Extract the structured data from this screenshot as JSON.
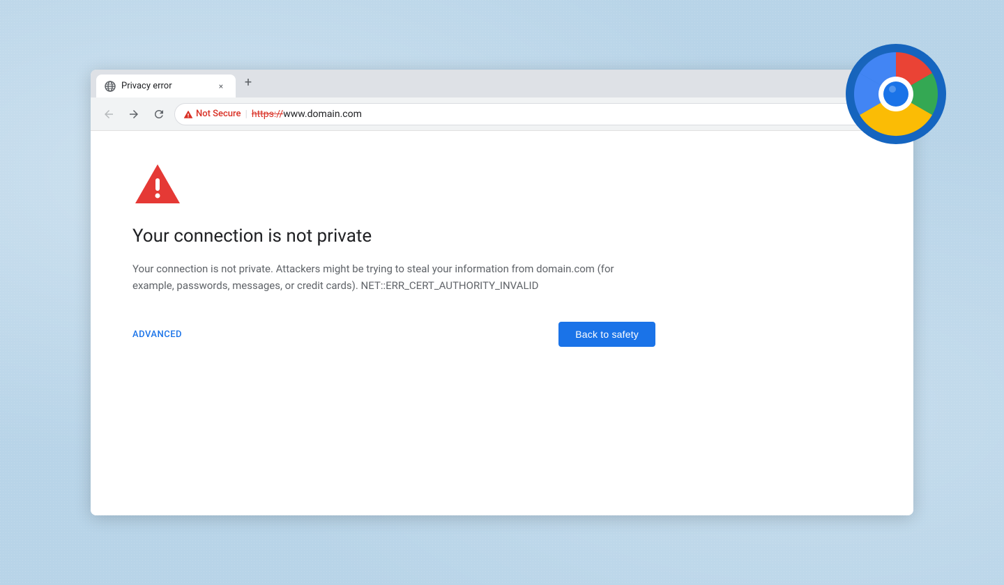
{
  "browser": {
    "tab": {
      "favicon_label": "globe-icon",
      "title": "Privacy error",
      "close_label": "×"
    },
    "new_tab_label": "+",
    "nav": {
      "back_label": "←",
      "forward_label": "→",
      "reload_label": "↻"
    },
    "omnibox": {
      "not_secure_label": "Not Secure",
      "divider": "|",
      "url_protocol": "https://",
      "url_domain": "www.domain.com"
    }
  },
  "error_page": {
    "title": "Your connection is not private",
    "description": "Your connection is not private. Attackers might be trying to steal your information from domain.com (for example, passwords, messages, or credit cards). NET::ERR_CERT_AUTHORITY_INVALID",
    "advanced_label": "ADVANCED",
    "back_to_safety_label": "Back to safety"
  },
  "colors": {
    "accent_blue": "#1a73e8",
    "not_secure_red": "#d93025",
    "error_triangle_red": "#e53935"
  }
}
